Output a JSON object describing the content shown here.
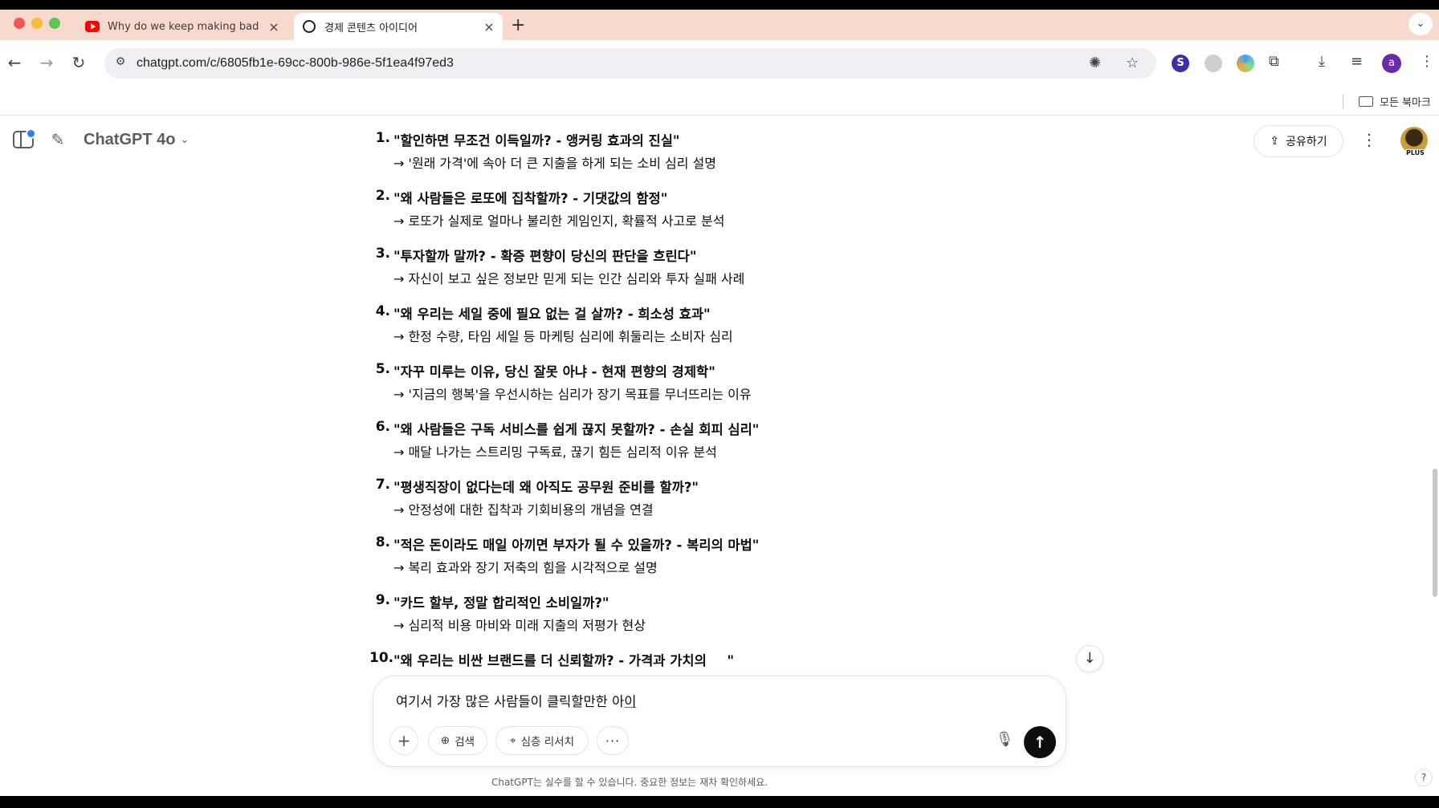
{
  "browser": {
    "tabs": [
      {
        "title": "Why do we keep making bad",
        "active": false,
        "icon": "youtube-icon"
      },
      {
        "title": "경제 콘텐츠 아이디어",
        "active": true,
        "icon": "chatgpt-icon"
      }
    ],
    "new_tab_label": "+",
    "url": "chatgpt.com/c/6805fb1e-69cc-800b-986e-5f1ea4f97ed3",
    "profile_initial": "a",
    "bookmark_folder": "모든 북마크"
  },
  "header": {
    "model_name": "ChatGPT 4o",
    "share_label": "공유하기",
    "plan_badge": "PLUS"
  },
  "conversation": {
    "items": [
      {
        "number": "1.",
        "title": "\"할인하면 무조건 이득일까? - 앵커링 효과의 진실\"",
        "desc": "→ '원래 가격'에 속아 더 큰 지출을 하게 되는 소비 심리 설명"
      },
      {
        "number": "2.",
        "title": "\"왜 사람들은 로또에 집착할까? - 기댓값의 함정\"",
        "desc": "→ 로또가 실제로 얼마나 불리한 게임인지, 확률적 사고로 분석"
      },
      {
        "number": "3.",
        "title": "\"투자할까 말까? - 확증 편향이 당신의 판단을 흐린다\"",
        "desc": "→ 자신이 보고 싶은 정보만 믿게 되는 인간 심리와 투자 실패 사례"
      },
      {
        "number": "4.",
        "title": "\"왜 우리는 세일 중에 필요 없는 걸 살까? - 희소성 효과\"",
        "desc": "→ 한정 수량, 타임 세일 등 마케팅 심리에 휘둘리는 소비자 심리"
      },
      {
        "number": "5.",
        "title": "\"자꾸 미루는 이유, 당신 잘못 아냐 - 현재 편향의 경제학\"",
        "desc": "→ '지금의 행복'을 우선시하는 심리가 장기 목표를 무너뜨리는 이유"
      },
      {
        "number": "6.",
        "title": "\"왜 사람들은 구독 서비스를 쉽게 끊지 못할까? - 손실 회피 심리\"",
        "desc": "→ 매달 나가는 스트리밍 구독료, 끊기 힘든 심리적 이유 분석"
      },
      {
        "number": "7.",
        "title": "\"평생직장이 없다는데 왜 아직도 공무원 준비를 할까?\"",
        "desc": "→ 안정성에 대한 집착과 기회비용의 개념을 연결"
      },
      {
        "number": "8.",
        "title": "\"적은 돈이라도 매일 아끼면 부자가 될 수 있을까? - 복리의 마법\"",
        "desc": "→ 복리 효과와 장기 저축의 힘을 시각적으로 설명"
      },
      {
        "number": "9.",
        "title": "\"카드 할부, 정말 합리적인 소비일까?\"",
        "desc": "→ 심리적 비용 마비와 미래 지출의 저평가 현상"
      },
      {
        "number": "10.",
        "title": "\"왜 우리는 비싼 브랜드를 더 신뢰할까? - 가격과 가치의 ",
        "title_tail": "\"",
        "desc": ""
      }
    ]
  },
  "composer": {
    "text_main": "여기서 가장 많은 사람들이 클릭할만한 아",
    "text_composing": "이",
    "plus_label": "+",
    "search_label": "검색",
    "research_label": "심층 리서치",
    "more_label": "···"
  },
  "footer": {
    "disclaimer": "ChatGPT는 실수를 할 수 있습니다. 중요한 정보는 재차 확인하세요.",
    "help_label": "?"
  },
  "colors": {
    "tabbar": "#f7d9cd",
    "accent_blue": "#2f7df6",
    "send_button": "#0d0d0d"
  }
}
